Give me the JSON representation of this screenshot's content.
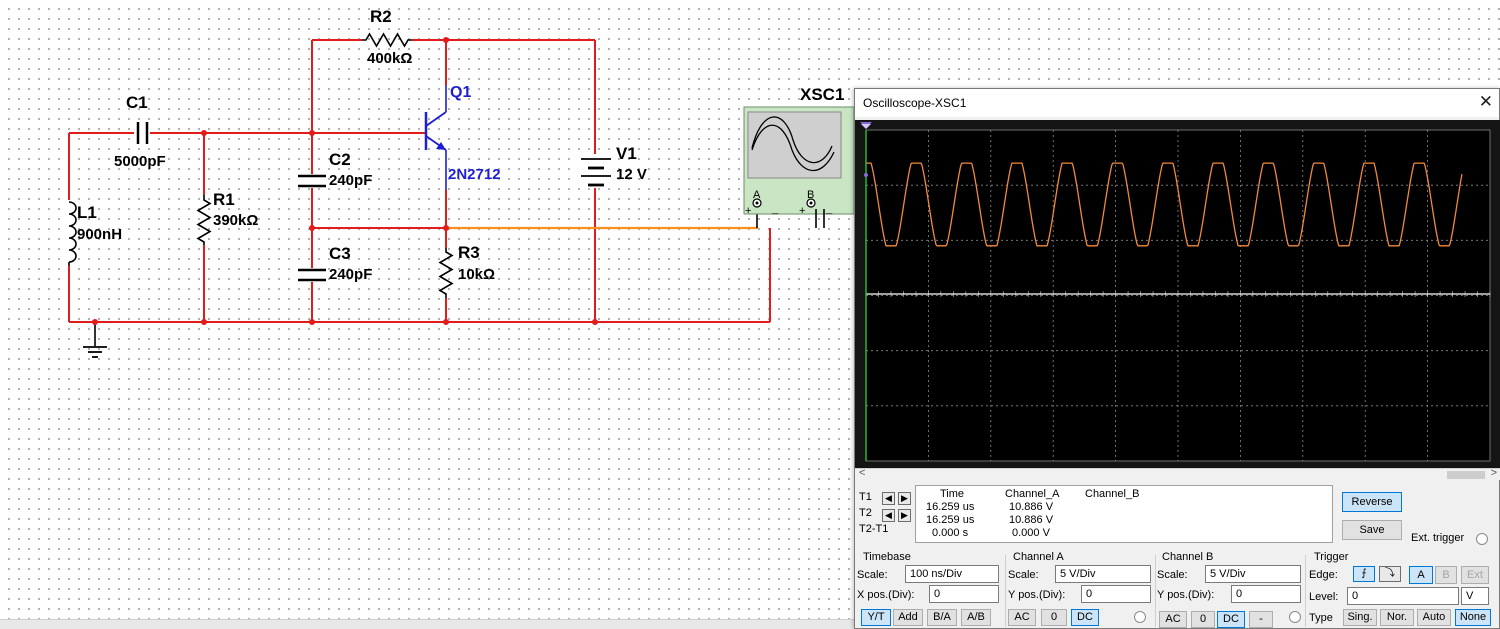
{
  "schematic": {
    "r2": {
      "name": "R2",
      "value": "400kΩ"
    },
    "q1": {
      "name": "Q1",
      "model": "2N2712"
    },
    "c1": {
      "name": "C1",
      "value": "5000pF"
    },
    "c2": {
      "name": "C2",
      "value": "240pF"
    },
    "c3": {
      "name": "C3",
      "value": "240pF"
    },
    "r1": {
      "name": "R1",
      "value": "390kΩ"
    },
    "l1": {
      "name": "L1",
      "value": "900nH"
    },
    "r3": {
      "name": "R3",
      "value": "10kΩ"
    },
    "v1": {
      "name": "V1",
      "value": "12 V"
    },
    "xsc1": {
      "name": "XSC1",
      "terminal_a": "A",
      "terminal_b": "B",
      "plus": "+",
      "minus": "_"
    }
  },
  "colors": {
    "wire": "#e21b1b",
    "probe_wire": "#f7901e",
    "transistor": "#1e1ed2",
    "trace_a": "#f08a3c",
    "trace_b": "#ffffff",
    "grid": "#8a8a8a",
    "screen_bg": "#000000"
  },
  "scope_window": {
    "title": "Oscilloscope-XSC1",
    "close_glyph": "✕",
    "scroll_left": "<",
    "scroll_right": ">",
    "cursor_labels": [
      "T1",
      "T2",
      "T2-T1"
    ],
    "arrow_left": "◀",
    "arrow_right": "▶",
    "readout": {
      "headers": {
        "time": "Time",
        "channel_a": "Channel_A",
        "channel_b": "Channel_B"
      },
      "rows": [
        {
          "time": "16.259 us",
          "channel_a": "10.886 V",
          "channel_b": ""
        },
        {
          "time": "16.259 us",
          "channel_a": "10.886 V",
          "channel_b": ""
        },
        {
          "time": "0.000 s",
          "channel_a": "0.000 V",
          "channel_b": ""
        }
      ]
    },
    "reverse_label": "Reverse",
    "save_label": "Save",
    "ext_trigger_label": "Ext. trigger",
    "timebase": {
      "title": "Timebase",
      "scale_label": "Scale:",
      "scale": "100 ns/Div",
      "xpos_label": "X pos.(Div):",
      "xpos": "0",
      "modes": [
        "Y/T",
        "Add",
        "B/A",
        "A/B"
      ],
      "selected": "Y/T"
    },
    "channel_a": {
      "title": "Channel A",
      "scale_label": "Scale:",
      "scale": "5  V/Div",
      "ypos_label": "Y pos.(Div):",
      "ypos": "0",
      "coupling": [
        "AC",
        "0",
        "DC"
      ],
      "selected": "DC"
    },
    "channel_b": {
      "title": "Channel B",
      "scale_label": "Scale:",
      "scale": "5  V/Div",
      "ypos_label": "Y pos.(Div):",
      "ypos": "0",
      "coupling": [
        "AC",
        "0",
        "DC",
        "-"
      ],
      "selected": "DC"
    },
    "trigger": {
      "title": "Trigger",
      "edge_label": "Edge:",
      "rising_glyph": "⨍",
      "falling_glyph": "⤵",
      "sources": [
        "A",
        "B",
        "Ext"
      ],
      "selected_source": "A",
      "level_label": "Level:",
      "level": "0",
      "level_unit": "V",
      "type_label": "Type",
      "types": [
        "Sing.",
        "Nor.",
        "Auto",
        "None"
      ],
      "selected_type": "None"
    },
    "trace_a": {
      "cycles": 12,
      "high_div": 2.4,
      "low_div": 0.9
    }
  }
}
